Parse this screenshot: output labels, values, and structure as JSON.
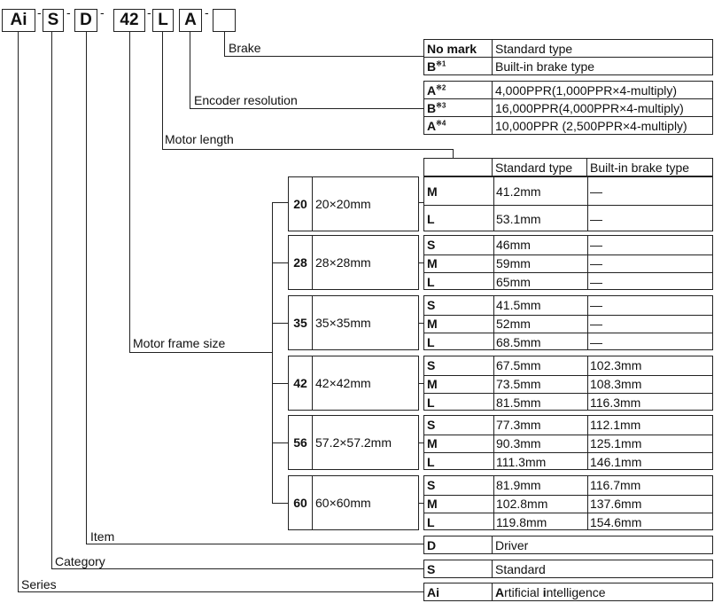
{
  "code": {
    "parts": [
      "Ai",
      "S",
      "D",
      "42",
      "L",
      "A",
      ""
    ],
    "separator": "-"
  },
  "sections": {
    "brake": {
      "label": "Brake",
      "rows": [
        {
          "code": "No mark",
          "note": "",
          "value": "Standard type"
        },
        {
          "code": "B",
          "note": "※1",
          "value": "Built-in brake type"
        }
      ]
    },
    "encoder": {
      "label": "Encoder resolution",
      "rows": [
        {
          "code": "A",
          "note": "※2",
          "value": "4,000PPR(1,000PPR×4-multiply)"
        },
        {
          "code": "B",
          "note": "※3",
          "value": "16,000PPR(4,000PPR×4-multiply)"
        },
        {
          "code": "A",
          "note": "※4",
          "value": "10,000PPR (2,500PPR×4-multiply)"
        }
      ]
    },
    "motor_length": {
      "label": "Motor length",
      "header": [
        "",
        "Standard type",
        "Built-in brake type"
      ]
    },
    "frame_size": {
      "label": "Motor frame size",
      "frames": [
        {
          "num": "20",
          "dim": "20×20mm",
          "rows": [
            {
              "len": "M",
              "std": "41.2mm",
              "brake": "—"
            },
            {
              "len": "L",
              "std": "53.1mm",
              "brake": "—"
            }
          ]
        },
        {
          "num": "28",
          "dim": "28×28mm",
          "rows": [
            {
              "len": "S",
              "std": "46mm",
              "brake": "—"
            },
            {
              "len": "M",
              "std": "59mm",
              "brake": "—"
            },
            {
              "len": "L",
              "std": "65mm",
              "brake": "—"
            }
          ]
        },
        {
          "num": "35",
          "dim": "35×35mm",
          "rows": [
            {
              "len": "S",
              "std": "41.5mm",
              "brake": "—"
            },
            {
              "len": "M",
              "std": "52mm",
              "brake": "—"
            },
            {
              "len": "L",
              "std": "68.5mm",
              "brake": "—"
            }
          ]
        },
        {
          "num": "42",
          "dim": "42×42mm",
          "rows": [
            {
              "len": "S",
              "std": "67.5mm",
              "brake": "102.3mm"
            },
            {
              "len": "M",
              "std": "73.5mm",
              "brake": "108.3mm"
            },
            {
              "len": "L",
              "std": "81.5mm",
              "brake": "116.3mm"
            }
          ]
        },
        {
          "num": "56",
          "dim": "57.2×57.2mm",
          "rows": [
            {
              "len": "S",
              "std": "77.3mm",
              "brake": "112.1mm"
            },
            {
              "len": "M",
              "std": "90.3mm",
              "brake": "125.1mm"
            },
            {
              "len": "L",
              "std": "111.3mm",
              "brake": "146.1mm"
            }
          ]
        },
        {
          "num": "60",
          "dim": "60×60mm",
          "rows": [
            {
              "len": "S",
              "std": "81.9mm",
              "brake": "116.7mm"
            },
            {
              "len": "M",
              "std": "102.8mm",
              "brake": "137.6mm"
            },
            {
              "len": "L",
              "std": "119.8mm",
              "brake": "154.6mm"
            }
          ]
        }
      ]
    },
    "item": {
      "label": "Item",
      "code": "D",
      "value": "Driver"
    },
    "category": {
      "label": "Category",
      "code": "S",
      "value": "Standard"
    },
    "series": {
      "label": "Series",
      "code": "Ai",
      "value_a": "A",
      "value_b": "rtificial ",
      "value_c": "i",
      "value_d": "ntelligence"
    }
  }
}
